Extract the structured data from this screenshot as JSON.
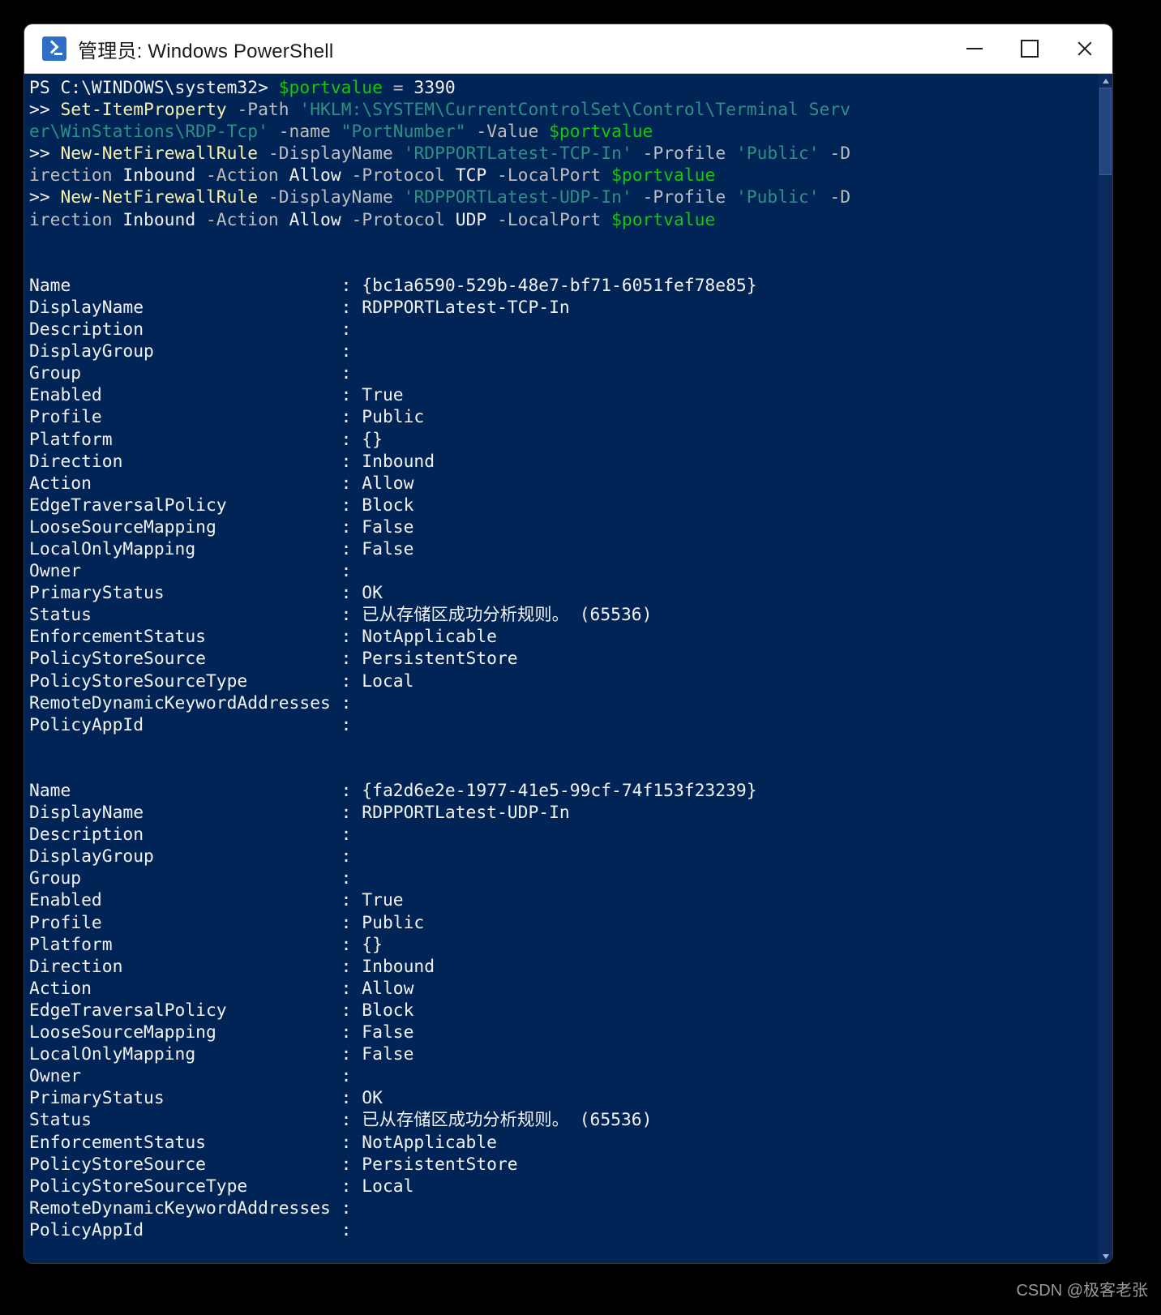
{
  "window": {
    "title": "管理员: Windows PowerShell",
    "icon": "powershell-icon",
    "controls": {
      "minimize": "—",
      "maximize": "□",
      "close": "✕"
    },
    "background_color": "#012456",
    "titlebar_color": "#ffffff"
  },
  "colors": {
    "background": "#012456",
    "foreground": "#f2f2f2",
    "variable_green": "#16c60c",
    "command_yellow": "#f9f1a5",
    "parameter_gray": "#bdbdbd",
    "string_teal": "#2e8f85"
  },
  "terminal": {
    "prompt": "PS C:\\WINDOWS\\system32>",
    "continuation": ">>",
    "command_lines": [
      {
        "prompt": "PS C:\\WINDOWS\\system32>",
        "tokens": [
          {
            "text": " ",
            "style": "white"
          },
          {
            "text": "$portvalue",
            "style": "green"
          },
          {
            "text": " ",
            "style": "white"
          },
          {
            "text": "=",
            "style": "gray"
          },
          {
            "text": " 3390",
            "style": "white"
          }
        ]
      },
      {
        "prompt": ">>",
        "tokens": [
          {
            "text": " ",
            "style": "white"
          },
          {
            "text": "Set-ItemProperty",
            "style": "yellow"
          },
          {
            "text": " ",
            "style": "white"
          },
          {
            "text": "-Path",
            "style": "gray"
          },
          {
            "text": " ",
            "style": "white"
          },
          {
            "text": "'HKLM:\\SYSTEM\\CurrentControlSet\\Control\\Terminal Server\\WinStations\\RDP-Tcp'",
            "style": "str"
          },
          {
            "text": " ",
            "style": "white"
          },
          {
            "text": "-name",
            "style": "gray"
          },
          {
            "text": " ",
            "style": "white"
          },
          {
            "text": "\"PortNumber\"",
            "style": "str"
          },
          {
            "text": " ",
            "style": "white"
          },
          {
            "text": "-Value",
            "style": "gray"
          },
          {
            "text": " ",
            "style": "white"
          },
          {
            "text": "$portvalue",
            "style": "green"
          }
        ]
      },
      {
        "prompt": ">>",
        "tokens": [
          {
            "text": " ",
            "style": "white"
          },
          {
            "text": "New-NetFirewallRule",
            "style": "yellow"
          },
          {
            "text": " ",
            "style": "white"
          },
          {
            "text": "-DisplayName",
            "style": "gray"
          },
          {
            "text": " ",
            "style": "white"
          },
          {
            "text": "'RDPPORTLatest-TCP-In'",
            "style": "str"
          },
          {
            "text": " ",
            "style": "white"
          },
          {
            "text": "-Profile",
            "style": "gray"
          },
          {
            "text": " ",
            "style": "white"
          },
          {
            "text": "'Public'",
            "style": "str"
          },
          {
            "text": " ",
            "style": "white"
          },
          {
            "text": "-Direction",
            "style": "gray"
          },
          {
            "text": " Inbound ",
            "style": "white"
          },
          {
            "text": "-Action",
            "style": "gray"
          },
          {
            "text": " Allow ",
            "style": "white"
          },
          {
            "text": "-Protocol",
            "style": "gray"
          },
          {
            "text": " TCP ",
            "style": "white"
          },
          {
            "text": "-LocalPort",
            "style": "gray"
          },
          {
            "text": " ",
            "style": "white"
          },
          {
            "text": "$portvalue",
            "style": "green"
          }
        ]
      },
      {
        "prompt": ">>",
        "tokens": [
          {
            "text": " ",
            "style": "white"
          },
          {
            "text": "New-NetFirewallRule",
            "style": "yellow"
          },
          {
            "text": " ",
            "style": "white"
          },
          {
            "text": "-DisplayName",
            "style": "gray"
          },
          {
            "text": " ",
            "style": "white"
          },
          {
            "text": "'RDPPORTLatest-UDP-In'",
            "style": "str"
          },
          {
            "text": " ",
            "style": "white"
          },
          {
            "text": "-Profile",
            "style": "gray"
          },
          {
            "text": " ",
            "style": "white"
          },
          {
            "text": "'Public'",
            "style": "str"
          },
          {
            "text": " ",
            "style": "white"
          },
          {
            "text": "-Direction",
            "style": "gray"
          },
          {
            "text": " Inbound ",
            "style": "white"
          },
          {
            "text": "-Action",
            "style": "gray"
          },
          {
            "text": " Allow ",
            "style": "white"
          },
          {
            "text": "-Protocol",
            "style": "gray"
          },
          {
            "text": " UDP ",
            "style": "white"
          },
          {
            "text": "-LocalPort",
            "style": "gray"
          },
          {
            "text": " ",
            "style": "white"
          },
          {
            "text": "$portvalue",
            "style": "green"
          }
        ]
      }
    ],
    "rule_blocks": [
      {
        "id": "rule-tcp",
        "properties": [
          {
            "name": "Name",
            "value": "{bc1a6590-529b-48e7-bf71-6051fef78e85}"
          },
          {
            "name": "DisplayName",
            "value": "RDPPORTLatest-TCP-In"
          },
          {
            "name": "Description",
            "value": ""
          },
          {
            "name": "DisplayGroup",
            "value": ""
          },
          {
            "name": "Group",
            "value": ""
          },
          {
            "name": "Enabled",
            "value": "True"
          },
          {
            "name": "Profile",
            "value": "Public"
          },
          {
            "name": "Platform",
            "value": "{}"
          },
          {
            "name": "Direction",
            "value": "Inbound"
          },
          {
            "name": "Action",
            "value": "Allow"
          },
          {
            "name": "EdgeTraversalPolicy",
            "value": "Block"
          },
          {
            "name": "LooseSourceMapping",
            "value": "False"
          },
          {
            "name": "LocalOnlyMapping",
            "value": "False"
          },
          {
            "name": "Owner",
            "value": ""
          },
          {
            "name": "PrimaryStatus",
            "value": "OK"
          },
          {
            "name": "Status",
            "value": "已从存储区成功分析规则。 (65536)"
          },
          {
            "name": "EnforcementStatus",
            "value": "NotApplicable"
          },
          {
            "name": "PolicyStoreSource",
            "value": "PersistentStore"
          },
          {
            "name": "PolicyStoreSourceType",
            "value": "Local"
          },
          {
            "name": "RemoteDynamicKeywordAddresses",
            "value": ""
          },
          {
            "name": "PolicyAppId",
            "value": ""
          }
        ]
      },
      {
        "id": "rule-udp",
        "properties": [
          {
            "name": "Name",
            "value": "{fa2d6e2e-1977-41e5-99cf-74f153f23239}"
          },
          {
            "name": "DisplayName",
            "value": "RDPPORTLatest-UDP-In"
          },
          {
            "name": "Description",
            "value": ""
          },
          {
            "name": "DisplayGroup",
            "value": ""
          },
          {
            "name": "Group",
            "value": ""
          },
          {
            "name": "Enabled",
            "value": "True"
          },
          {
            "name": "Profile",
            "value": "Public"
          },
          {
            "name": "Platform",
            "value": "{}"
          },
          {
            "name": "Direction",
            "value": "Inbound"
          },
          {
            "name": "Action",
            "value": "Allow"
          },
          {
            "name": "EdgeTraversalPolicy",
            "value": "Block"
          },
          {
            "name": "LooseSourceMapping",
            "value": "False"
          },
          {
            "name": "LocalOnlyMapping",
            "value": "False"
          },
          {
            "name": "Owner",
            "value": ""
          },
          {
            "name": "PrimaryStatus",
            "value": "OK"
          },
          {
            "name": "Status",
            "value": "已从存储区成功分析规则。 (65536)"
          },
          {
            "name": "EnforcementStatus",
            "value": "NotApplicable"
          },
          {
            "name": "PolicyStoreSource",
            "value": "PersistentStore"
          },
          {
            "name": "PolicyStoreSourceType",
            "value": "Local"
          },
          {
            "name": "RemoteDynamicKeywordAddresses",
            "value": ""
          },
          {
            "name": "PolicyAppId",
            "value": ""
          }
        ]
      }
    ]
  },
  "watermark": "CSDN @极客老张"
}
